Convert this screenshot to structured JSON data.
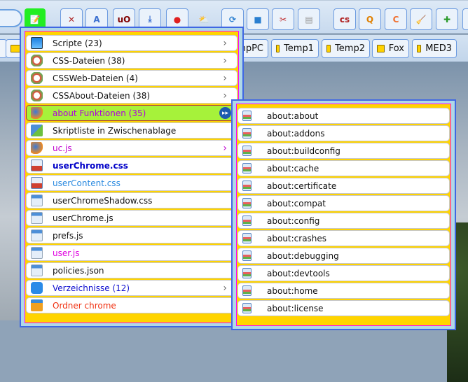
{
  "toolbar": {
    "buttons": [
      {
        "name": "menu-edit-icon",
        "glyph": "📝",
        "color": "#22ee22"
      },
      {
        "name": "close-icon",
        "glyph": "✕",
        "color": "#b03030"
      },
      {
        "name": "translate-icon",
        "glyph": "A",
        "color": "#3a6fd0"
      },
      {
        "name": "ublock-icon",
        "glyph": "uO",
        "color": "#800000"
      },
      {
        "name": "download-icon",
        "glyph": "⤓",
        "color": "#3a6fd0"
      },
      {
        "name": "red-extension-icon",
        "glyph": "●",
        "color": "#e02020"
      },
      {
        "name": "weather-icon",
        "glyph": "⛅",
        "color": "#d0a020"
      },
      {
        "name": "sync-icon",
        "glyph": "⟳",
        "color": "#2a7fd0"
      },
      {
        "name": "folder-icon",
        "glyph": "■",
        "color": "#2a7fd0"
      },
      {
        "name": "tools-icon",
        "glyph": "✂",
        "color": "#c03030"
      },
      {
        "name": "pdf-icon",
        "glyph": "▤",
        "color": "#999"
      },
      {
        "name": "css-icon",
        "glyph": "cs",
        "color": "#b02020"
      },
      {
        "name": "search-q-icon",
        "glyph": "Q",
        "color": "#e08000"
      },
      {
        "name": "orange-extension-icon",
        "glyph": "C",
        "color": "#f07030"
      },
      {
        "name": "broom-icon",
        "glyph": "🧹",
        "color": "#c09030"
      },
      {
        "name": "puzzle-icon",
        "glyph": "✚",
        "color": "#2a9a2a"
      },
      {
        "name": "more-icon",
        "glyph": "⇩",
        "color": "#e05020"
      }
    ]
  },
  "bookmarks": [
    {
      "label": "npPC"
    },
    {
      "label": "Temp1"
    },
    {
      "label": "Temp2"
    },
    {
      "label": "Fox"
    },
    {
      "label": "MED3"
    }
  ],
  "menu": {
    "items": [
      {
        "label": "Scripte (23)",
        "icon": "computer-icon",
        "sub": true,
        "color": "#111"
      },
      {
        "label": "CSS-Dateien (38)",
        "icon": "css-icon",
        "sub": true,
        "color": "#111"
      },
      {
        "label": "CSSWeb-Dateien (4)",
        "icon": "css-icon",
        "sub": true,
        "color": "#111"
      },
      {
        "label": "CSSAbout-Dateien (38)",
        "icon": "css-icon",
        "sub": true,
        "color": "#111"
      },
      {
        "label": "about Funktionen (35)",
        "icon": "firefox-icon",
        "sub": true,
        "color": "#b000e0",
        "active": true
      },
      {
        "label": "Skriptliste in Zwischenablage",
        "icon": "clipboard-icon",
        "color": "#111"
      },
      {
        "label": "uc.js",
        "icon": "firefox-icon",
        "sub": true,
        "color": "#c000d0"
      },
      {
        "label": "userChrome.css",
        "icon": "css-file-icon",
        "color": "#0000c8",
        "bold": true
      },
      {
        "label": "userContent.css",
        "icon": "css-file-icon",
        "color": "#2a8ae0"
      },
      {
        "label": "userChromeShadow.css",
        "icon": "file-icon",
        "color": "#111"
      },
      {
        "label": "userChrome.js",
        "icon": "file-icon",
        "color": "#111"
      },
      {
        "label": "prefs.js",
        "icon": "file-icon",
        "color": "#111"
      },
      {
        "label": "user.js",
        "icon": "file-icon",
        "color": "#e000e0"
      },
      {
        "label": "policies.json",
        "icon": "file-icon",
        "color": "#111"
      },
      {
        "label": "Verzeichnisse (12)",
        "icon": "arrow-right-icon",
        "sub": true,
        "color": "#1010d0"
      },
      {
        "label": "Ordner chrome",
        "icon": "folder-open-icon",
        "color": "#f03010"
      }
    ]
  },
  "submenu": {
    "items": [
      "about:about",
      "about:addons",
      "about:buildconfig",
      "about:cache",
      "about:certificate",
      "about:compat",
      "about:config",
      "about:crashes",
      "about:debugging",
      "about:devtools",
      "about:home",
      "about:license"
    ]
  }
}
